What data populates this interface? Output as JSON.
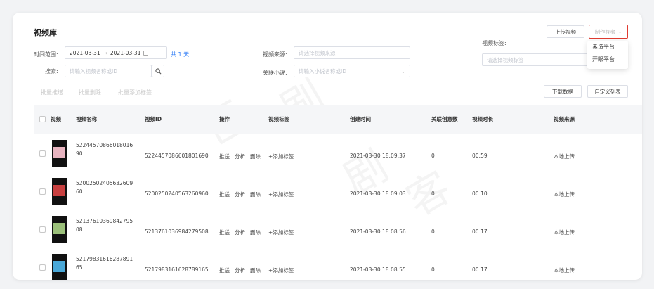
{
  "page": {
    "title": "视频库"
  },
  "filters": {
    "time_range_label": "时间范围:",
    "date_start": "2021-03-31",
    "date_separator": "→",
    "date_end": "2021-03-31",
    "total_count": "共 1 天",
    "search_label": "搜索:",
    "search_placeholder": "请输入视频名称或ID",
    "video_source_label": "视频来源:",
    "video_source_placeholder": "请选择视频来源",
    "related_novel_label": "关联小说:",
    "related_novel_placeholder": "请输入小说名称或ID",
    "video_tags_label": "视频标签:",
    "video_tags_placeholder": "请选择视频标签"
  },
  "header_actions": {
    "upload_video": "上传视频",
    "make_video": "制作视频",
    "make_video_menu": [
      "素造平台",
      "开眼平台"
    ]
  },
  "batch_actions": {
    "batch_push": "批量推送",
    "batch_delete": "批量删除",
    "batch_add_tags": "批量添加标签",
    "download_data": "下载数据",
    "custom_columns": "自定义列表"
  },
  "table": {
    "columns": [
      "视频",
      "视频名称",
      "视频ID",
      "操作",
      "视频标签",
      "创建时间",
      "关联创意数",
      "视频时长",
      "视频来源"
    ],
    "action_labels": [
      "推送",
      "分析",
      "删除"
    ],
    "add_tag_label": "+添加标签",
    "rows": [
      {
        "name_line1": "52244570866018016",
        "name_line2": "90",
        "id": "5224457086601801690",
        "created": "2021-03-30 18:09:37",
        "creatives": "0",
        "duration": "00:59",
        "source": "本地上传",
        "thumb_color": "#e8b4c0"
      },
      {
        "name_line1": "52002502405632609",
        "name_line2": "60",
        "id": "5200250240563260960",
        "created": "2021-03-30 18:09:03",
        "creatives": "0",
        "duration": "00:10",
        "source": "本地上传",
        "thumb_color": "#c84040"
      },
      {
        "name_line1": "52137610369842795",
        "name_line2": "08",
        "id": "5213761036984279508",
        "created": "2021-03-30 18:08:56",
        "creatives": "0",
        "duration": "00:17",
        "source": "本地上传",
        "thumb_color": "#9bc07a"
      },
      {
        "name_line1": "52179831616287891",
        "name_line2": "65",
        "id": "5217983161628789165",
        "created": "2021-03-30 18:08:55",
        "creatives": "0",
        "duration": "00:17",
        "source": "本地上传",
        "thumb_color": "#4aa8d8"
      }
    ]
  },
  "colors": {
    "accent": "#2f7cf6",
    "highlight_border": "#e03c31"
  }
}
